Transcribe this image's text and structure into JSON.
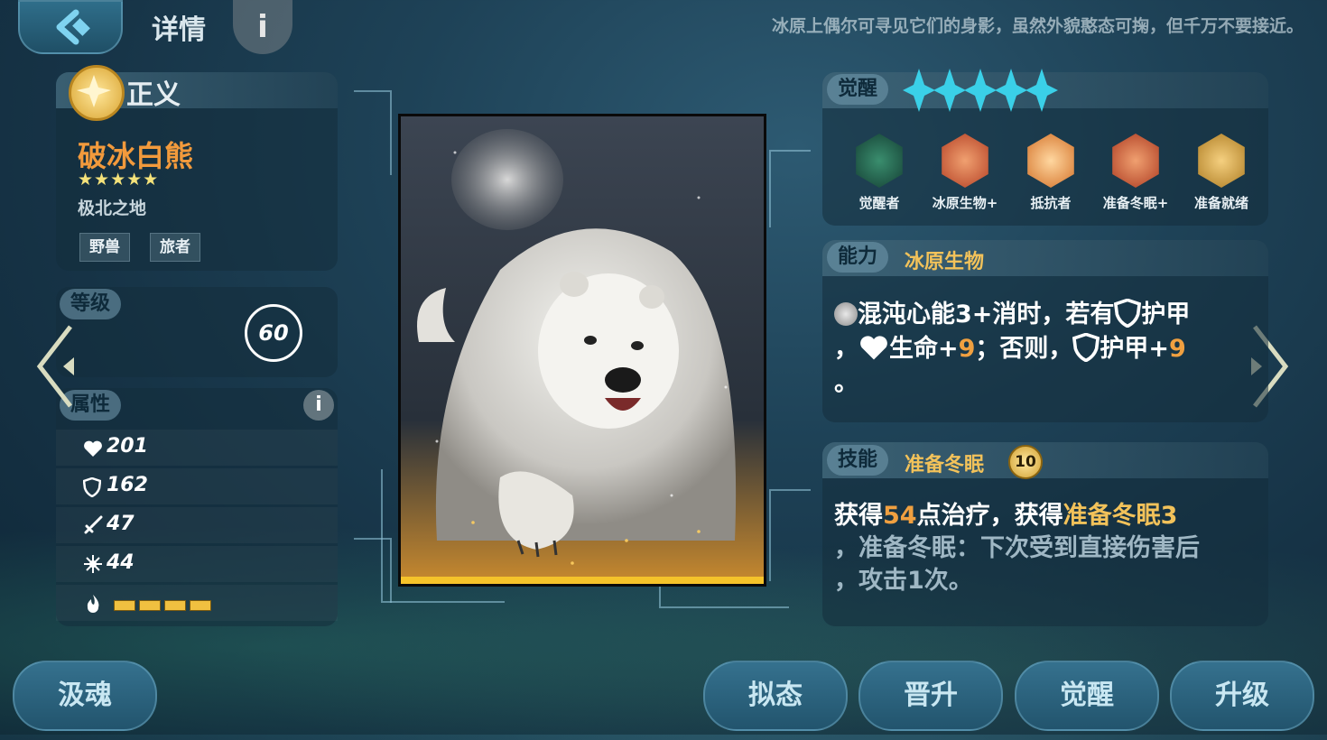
{
  "header": {
    "title": "详情",
    "info_icon": "i",
    "flavor_text": "冰原上偶尔可寻见它们的身影，虽然外貌憨态可掬，但千万不要接近。"
  },
  "faction": {
    "name": "正义",
    "icon": "star-emblem-icon"
  },
  "unit": {
    "name": "破冰白熊",
    "stars": 5,
    "star_glyphs": "★★★★★",
    "region": "极北之地",
    "tags": [
      "野兽",
      "旅者"
    ]
  },
  "level": {
    "label": "等级",
    "value": "60"
  },
  "attributes": {
    "label": "属性",
    "info": "i",
    "stats": [
      {
        "icon": "heart-icon",
        "value": "201"
      },
      {
        "icon": "shield-icon",
        "value": "162"
      },
      {
        "icon": "sword-icon",
        "value": "47"
      },
      {
        "icon": "spark-icon",
        "value": "44"
      }
    ],
    "energy_segments": 4
  },
  "awaken": {
    "label": "觉醒",
    "stars": 5,
    "skills": [
      {
        "label": "觉醒者",
        "icon": "awakener-icon",
        "color": "#2f8a6a"
      },
      {
        "label": "冰原生物+",
        "icon": "bear-figure-icon",
        "color": "#d0582a"
      },
      {
        "label": "抵抗者",
        "icon": "hexagon-shield-icon",
        "color": "#e07a30"
      },
      {
        "label": "准备冬眠+",
        "icon": "hibernate-figure-icon",
        "color": "#c8482a"
      },
      {
        "label": "准备就绪",
        "icon": "lightning-icon",
        "color": "#c99a3a"
      }
    ]
  },
  "ability": {
    "label": "能力",
    "name": "冰原生物",
    "line1": "混沌心能3+消时，若有",
    "armor1": "护甲",
    "line2_prefix": "，",
    "life": "生命+",
    "life_value": "9",
    "else": "；否则，",
    "armor2": "护甲+",
    "armor_value": "9",
    "line3": "。"
  },
  "skill": {
    "label": "技能",
    "name": "准备冬眠",
    "cost": "10",
    "desc_a": "获得",
    "heal": "54",
    "desc_b": "点治疗，获得",
    "buff": "准备冬眠3",
    "desc_c": "，准备冬眠：下次受到直接伤害后",
    "desc_d": "，攻击1次。"
  },
  "buttons": {
    "soul": "汲魂",
    "mimic": "拟态",
    "promote": "晋升",
    "awaken": "觉醒",
    "upgrade": "升级"
  }
}
